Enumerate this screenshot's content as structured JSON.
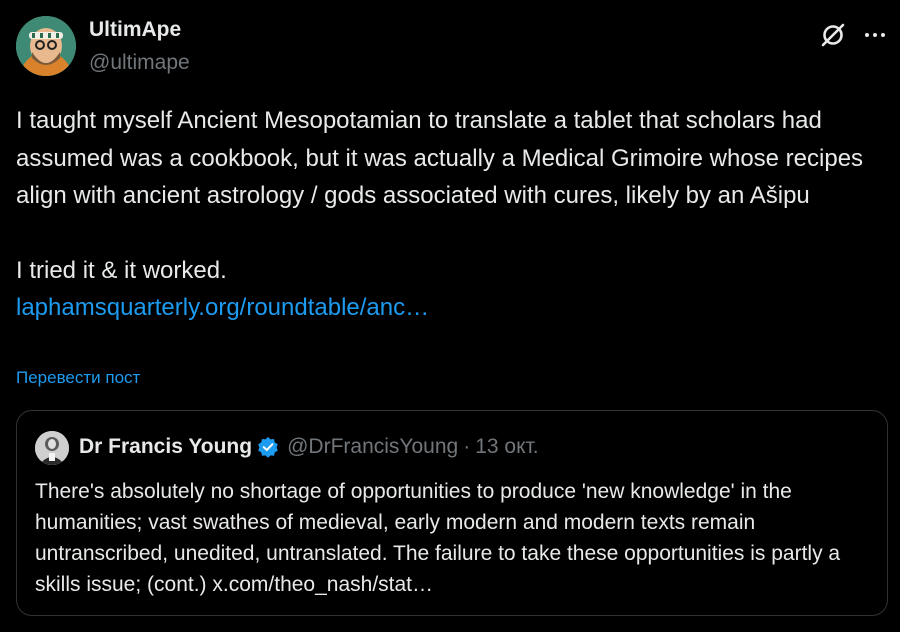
{
  "author": {
    "display_name": "UltimApe",
    "handle": "@ultimape"
  },
  "tweet": {
    "paragraph1": "I taught myself Ancient Mesopotamian to translate a tablet that scholars had assumed was a cookbook, but it was actually a Medical Grimoire whose recipes align with ancient astrology / gods associated with cures, likely by an Ašipu",
    "paragraph2": "I tried it & it worked.",
    "link_text": "laphamsquarterly.org/roundtable/anc…",
    "translate_label": "Перевести пост"
  },
  "quoted": {
    "display_name": "Dr Francis Young",
    "handle": "@DrFrancisYoung",
    "separator": "·",
    "date": "13 окт.",
    "text": "There's absolutely no shortage of opportunities to produce 'new knowledge' in the humanities; vast swathes of medieval, early modern and modern texts remain untranscribed, unedited, untranslated. The failure to take these opportunities is partly a skills issue; (cont.)",
    "link_text": "x.com/theo_nash/stat…"
  },
  "icons": {
    "grok": "grok-icon",
    "more": "more-options-icon",
    "verified": "verified-badge-icon"
  },
  "colors": {
    "background": "#000000",
    "text": "#e7e9ea",
    "secondary": "#71767b",
    "link": "#1d9bf0",
    "border": "#2f3336"
  }
}
